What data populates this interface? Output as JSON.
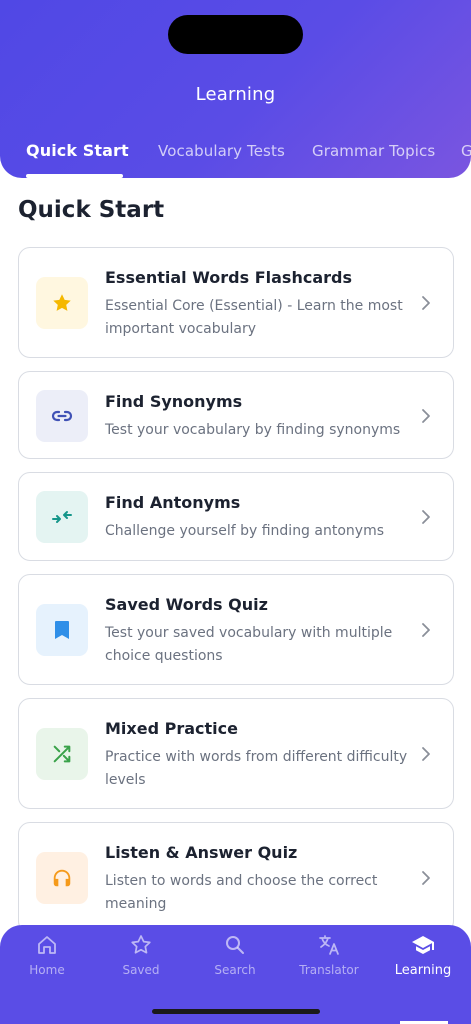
{
  "header": {
    "title": "Learning",
    "tabs": [
      {
        "label": "Quick Start",
        "active": true
      },
      {
        "label": "Vocabulary Tests",
        "active": false
      },
      {
        "label": "Grammar Topics",
        "active": false
      },
      {
        "label": "G",
        "active": false
      }
    ]
  },
  "main": {
    "section_title": "Quick Start",
    "cards": [
      {
        "title": "Essential Words Flashcards",
        "desc": "Essential Core (Essential) - Learn the most important vocabulary",
        "icon": "star-icon",
        "icon_bg": "#fff7e0",
        "icon_color": "#f5b800"
      },
      {
        "title": "Find Synonyms",
        "desc": "Test your vocabulary by finding synonyms",
        "icon": "link-icon",
        "icon_bg": "#eceef8",
        "icon_color": "#3f51b5"
      },
      {
        "title": "Find Antonyms",
        "desc": "Challenge yourself by finding antonyms",
        "icon": "compare-arrows-icon",
        "icon_bg": "#e4f4f2",
        "icon_color": "#15968a"
      },
      {
        "title": "Saved Words Quiz",
        "desc": "Test your saved vocabulary with multiple choice questions",
        "icon": "bookmark-icon",
        "icon_bg": "#e6f2fd",
        "icon_color": "#2f8fe8"
      },
      {
        "title": "Mixed Practice",
        "desc": "Practice with words from different difficulty levels",
        "icon": "shuffle-icon",
        "icon_bg": "#e9f5ea",
        "icon_color": "#3aa24a"
      },
      {
        "title": "Listen & Answer Quiz",
        "desc": "Listen to words and choose the correct meaning",
        "icon": "headphones-icon",
        "icon_bg": "#fff0e2",
        "icon_color": "#f59a1b"
      }
    ]
  },
  "bottom_nav": {
    "items": [
      {
        "label": "Home",
        "icon": "home-icon",
        "active": false
      },
      {
        "label": "Saved",
        "icon": "star-outline-icon",
        "active": false
      },
      {
        "label": "Search",
        "icon": "search-icon",
        "active": false
      },
      {
        "label": "Translator",
        "icon": "translate-icon",
        "active": false
      },
      {
        "label": "Learning",
        "icon": "graduation-cap-icon",
        "active": true
      }
    ]
  },
  "colors": {
    "header_gradient_start": "#5048e5",
    "header_gradient_end": "#7a55e0",
    "nav_bg": "#5a4de6"
  }
}
